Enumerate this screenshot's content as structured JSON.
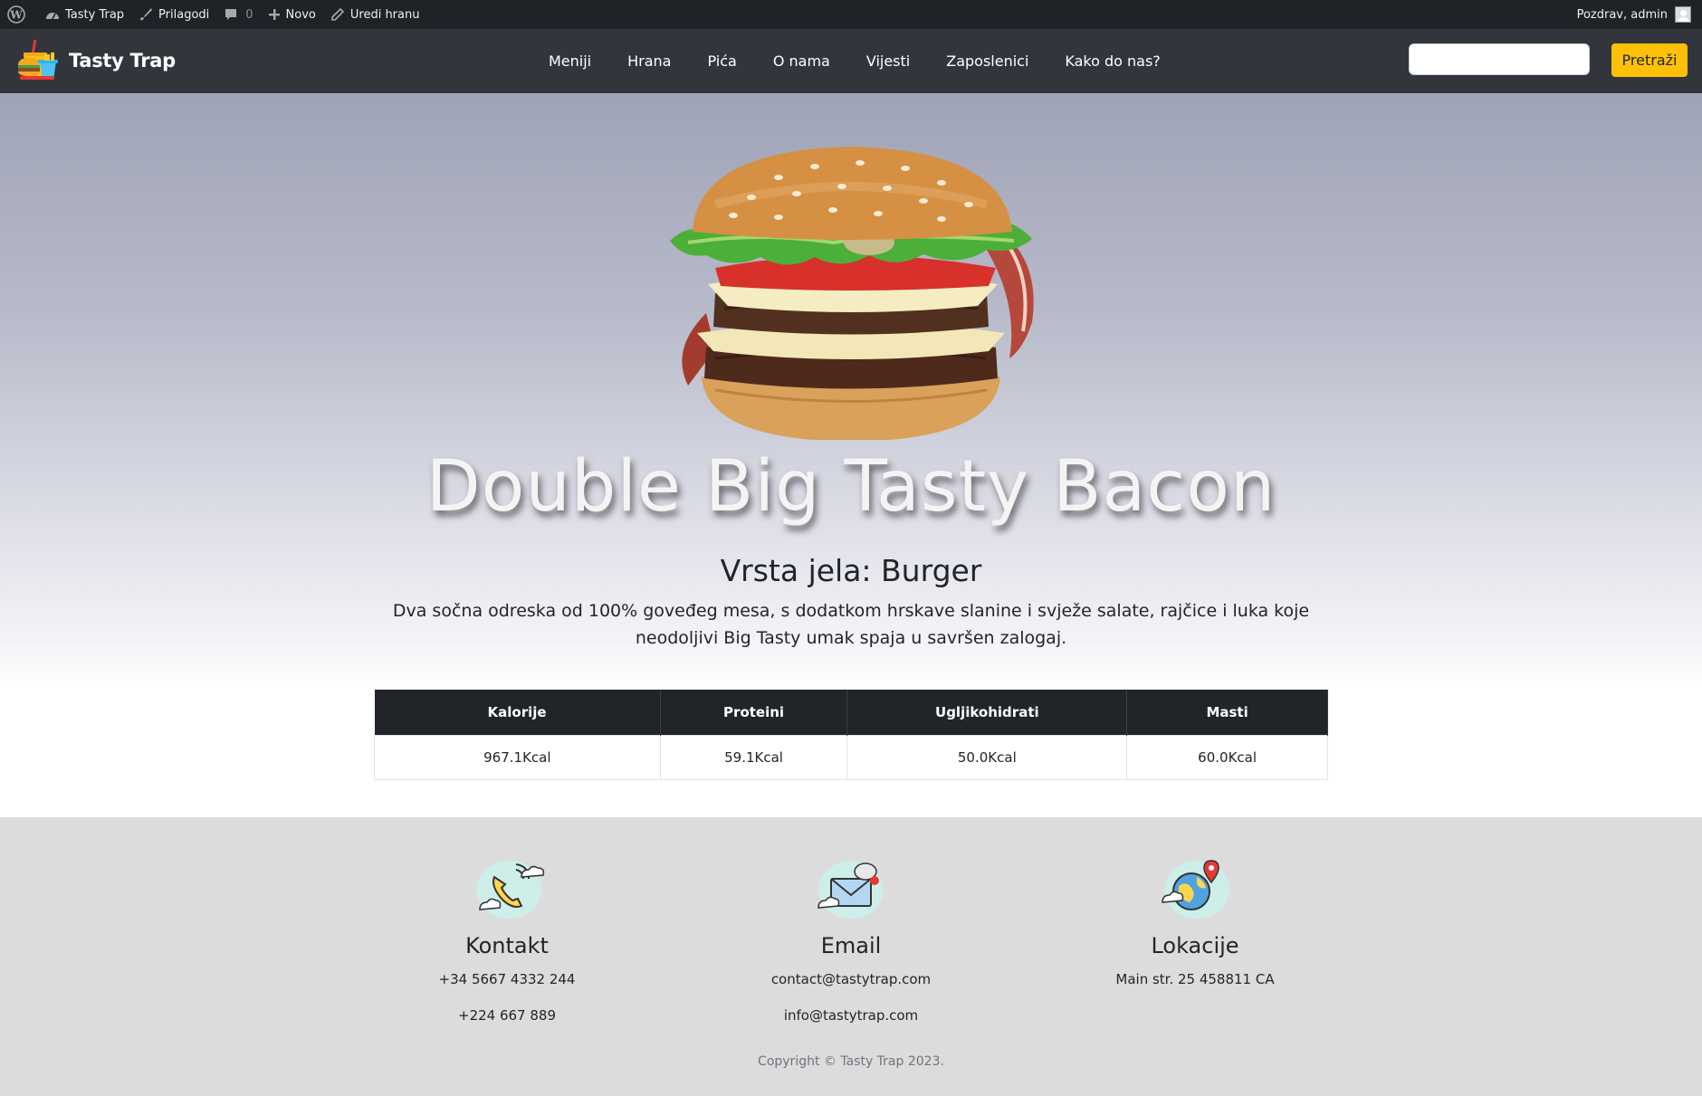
{
  "adminbar": {
    "site_name": "Tasty Trap",
    "customize": "Prilagodi",
    "comments_count": "0",
    "new": "Novo",
    "edit": "Uredi hranu",
    "greeting": "Pozdrav, admin"
  },
  "navbar": {
    "brand": "Tasty Trap",
    "links": [
      "Meniji",
      "Hrana",
      "Pića",
      "O nama",
      "Vijesti",
      "Zaposlenici",
      "Kako do nas?"
    ],
    "search_placeholder": "",
    "search_button": "Pretraži",
    "accent_color": "#ffc107"
  },
  "dish": {
    "title": "Double Big Tasty Bacon",
    "type": "Vrsta jela: Burger",
    "description": "Dva sočna odreska od 100% goveđeg mesa, s dodatkom hrskave slanine i svježe salate, rajčice i luka koje neodoljivi Big Tasty umak spaja u savršen zalogaj."
  },
  "nutrition": {
    "headers": [
      "Kalorije",
      "Proteini",
      "Ugljikohidrati",
      "Masti"
    ],
    "values": [
      "967.1Kcal",
      "59.1Kcal",
      "50.0Kcal",
      "60.0Kcal"
    ]
  },
  "footer": {
    "contact": {
      "title": "Kontakt",
      "lines": [
        "+34 5667 4332 244",
        "+224 667 889"
      ],
      "icon": "phone-icon"
    },
    "email": {
      "title": "Email",
      "lines": [
        "contact@tastytrap.com",
        "info@tastytrap.com"
      ],
      "icon": "envelope-icon"
    },
    "location": {
      "title": "Lokacije",
      "lines": [
        "Main str. 25 458811 CA"
      ],
      "icon": "globe-pin-icon"
    },
    "copyright": "Copyright © Tasty Trap 2023."
  }
}
